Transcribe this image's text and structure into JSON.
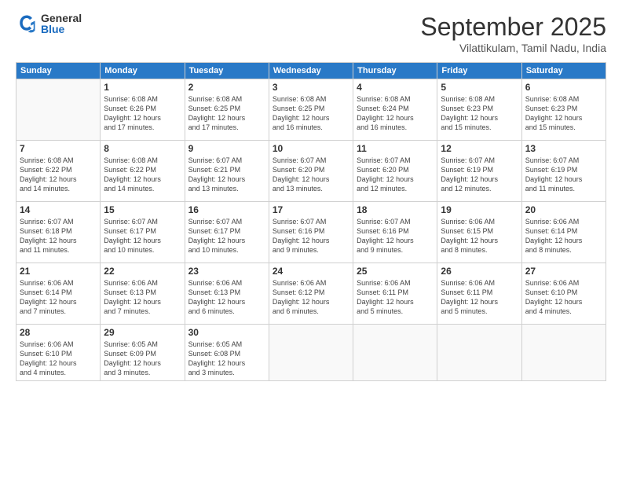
{
  "logo": {
    "general": "General",
    "blue": "Blue"
  },
  "header": {
    "title": "September 2025",
    "location": "Vilattikulam, Tamil Nadu, India"
  },
  "weekdays": [
    "Sunday",
    "Monday",
    "Tuesday",
    "Wednesday",
    "Thursday",
    "Friday",
    "Saturday"
  ],
  "weeks": [
    [
      {
        "day": "",
        "info": ""
      },
      {
        "day": "1",
        "info": "Sunrise: 6:08 AM\nSunset: 6:26 PM\nDaylight: 12 hours\nand 17 minutes."
      },
      {
        "day": "2",
        "info": "Sunrise: 6:08 AM\nSunset: 6:25 PM\nDaylight: 12 hours\nand 17 minutes."
      },
      {
        "day": "3",
        "info": "Sunrise: 6:08 AM\nSunset: 6:25 PM\nDaylight: 12 hours\nand 16 minutes."
      },
      {
        "day": "4",
        "info": "Sunrise: 6:08 AM\nSunset: 6:24 PM\nDaylight: 12 hours\nand 16 minutes."
      },
      {
        "day": "5",
        "info": "Sunrise: 6:08 AM\nSunset: 6:23 PM\nDaylight: 12 hours\nand 15 minutes."
      },
      {
        "day": "6",
        "info": "Sunrise: 6:08 AM\nSunset: 6:23 PM\nDaylight: 12 hours\nand 15 minutes."
      }
    ],
    [
      {
        "day": "7",
        "info": "Sunrise: 6:08 AM\nSunset: 6:22 PM\nDaylight: 12 hours\nand 14 minutes."
      },
      {
        "day": "8",
        "info": "Sunrise: 6:08 AM\nSunset: 6:22 PM\nDaylight: 12 hours\nand 14 minutes."
      },
      {
        "day": "9",
        "info": "Sunrise: 6:07 AM\nSunset: 6:21 PM\nDaylight: 12 hours\nand 13 minutes."
      },
      {
        "day": "10",
        "info": "Sunrise: 6:07 AM\nSunset: 6:20 PM\nDaylight: 12 hours\nand 13 minutes."
      },
      {
        "day": "11",
        "info": "Sunrise: 6:07 AM\nSunset: 6:20 PM\nDaylight: 12 hours\nand 12 minutes."
      },
      {
        "day": "12",
        "info": "Sunrise: 6:07 AM\nSunset: 6:19 PM\nDaylight: 12 hours\nand 12 minutes."
      },
      {
        "day": "13",
        "info": "Sunrise: 6:07 AM\nSunset: 6:19 PM\nDaylight: 12 hours\nand 11 minutes."
      }
    ],
    [
      {
        "day": "14",
        "info": "Sunrise: 6:07 AM\nSunset: 6:18 PM\nDaylight: 12 hours\nand 11 minutes."
      },
      {
        "day": "15",
        "info": "Sunrise: 6:07 AM\nSunset: 6:17 PM\nDaylight: 12 hours\nand 10 minutes."
      },
      {
        "day": "16",
        "info": "Sunrise: 6:07 AM\nSunset: 6:17 PM\nDaylight: 12 hours\nand 10 minutes."
      },
      {
        "day": "17",
        "info": "Sunrise: 6:07 AM\nSunset: 6:16 PM\nDaylight: 12 hours\nand 9 minutes."
      },
      {
        "day": "18",
        "info": "Sunrise: 6:07 AM\nSunset: 6:16 PM\nDaylight: 12 hours\nand 9 minutes."
      },
      {
        "day": "19",
        "info": "Sunrise: 6:06 AM\nSunset: 6:15 PM\nDaylight: 12 hours\nand 8 minutes."
      },
      {
        "day": "20",
        "info": "Sunrise: 6:06 AM\nSunset: 6:14 PM\nDaylight: 12 hours\nand 8 minutes."
      }
    ],
    [
      {
        "day": "21",
        "info": "Sunrise: 6:06 AM\nSunset: 6:14 PM\nDaylight: 12 hours\nand 7 minutes."
      },
      {
        "day": "22",
        "info": "Sunrise: 6:06 AM\nSunset: 6:13 PM\nDaylight: 12 hours\nand 7 minutes."
      },
      {
        "day": "23",
        "info": "Sunrise: 6:06 AM\nSunset: 6:13 PM\nDaylight: 12 hours\nand 6 minutes."
      },
      {
        "day": "24",
        "info": "Sunrise: 6:06 AM\nSunset: 6:12 PM\nDaylight: 12 hours\nand 6 minutes."
      },
      {
        "day": "25",
        "info": "Sunrise: 6:06 AM\nSunset: 6:11 PM\nDaylight: 12 hours\nand 5 minutes."
      },
      {
        "day": "26",
        "info": "Sunrise: 6:06 AM\nSunset: 6:11 PM\nDaylight: 12 hours\nand 5 minutes."
      },
      {
        "day": "27",
        "info": "Sunrise: 6:06 AM\nSunset: 6:10 PM\nDaylight: 12 hours\nand 4 minutes."
      }
    ],
    [
      {
        "day": "28",
        "info": "Sunrise: 6:06 AM\nSunset: 6:10 PM\nDaylight: 12 hours\nand 4 minutes."
      },
      {
        "day": "29",
        "info": "Sunrise: 6:05 AM\nSunset: 6:09 PM\nDaylight: 12 hours\nand 3 minutes."
      },
      {
        "day": "30",
        "info": "Sunrise: 6:05 AM\nSunset: 6:08 PM\nDaylight: 12 hours\nand 3 minutes."
      },
      {
        "day": "",
        "info": ""
      },
      {
        "day": "",
        "info": ""
      },
      {
        "day": "",
        "info": ""
      },
      {
        "day": "",
        "info": ""
      }
    ]
  ]
}
